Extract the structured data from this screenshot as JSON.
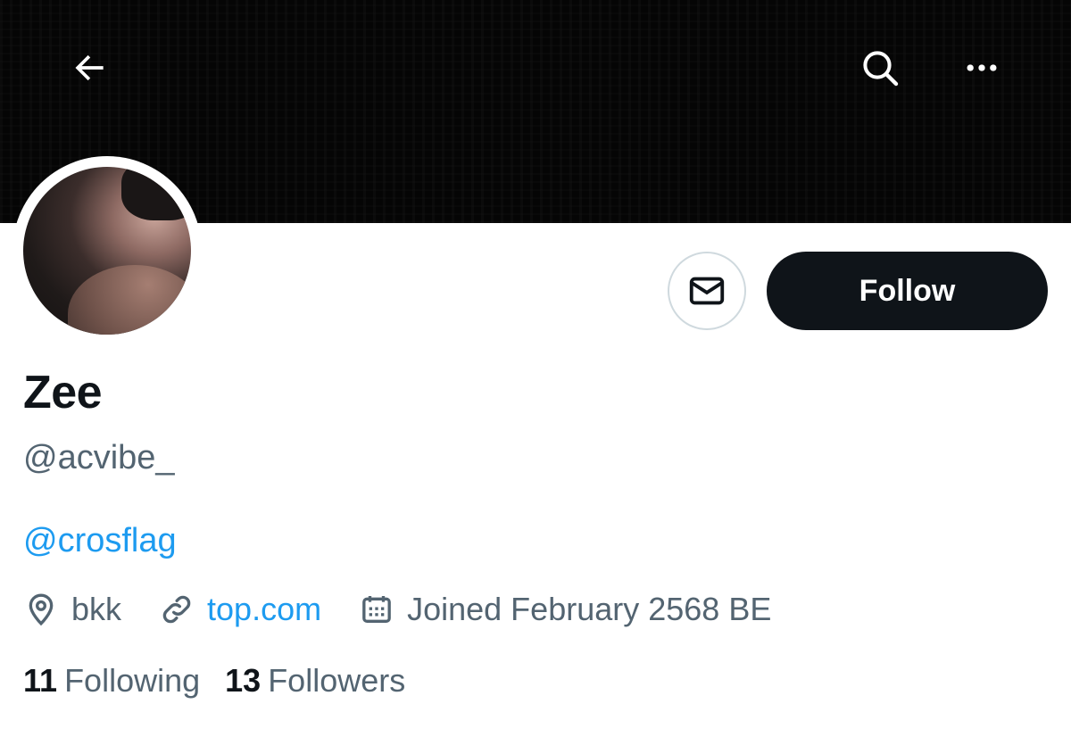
{
  "header": {
    "back_icon": "arrow-left-icon",
    "search_icon": "search-icon",
    "more_icon": "ellipsis-icon"
  },
  "profile": {
    "display_name": "Zee",
    "handle": "@acvibe_",
    "bio_mention": "@crosflag",
    "location": "bkk",
    "website": "top.com",
    "joined": "Joined February 2568 BE"
  },
  "actions": {
    "message_icon": "envelope-icon",
    "follow_label": "Follow"
  },
  "stats": {
    "following_count": "11",
    "following_label": "Following",
    "followers_count": "13",
    "followers_label": "Followers"
  },
  "colors": {
    "text_primary": "#0f1419",
    "text_secondary": "#536471",
    "link": "#1d9bf0",
    "button_dark": "#0f1419",
    "border": "#cfd9de"
  }
}
